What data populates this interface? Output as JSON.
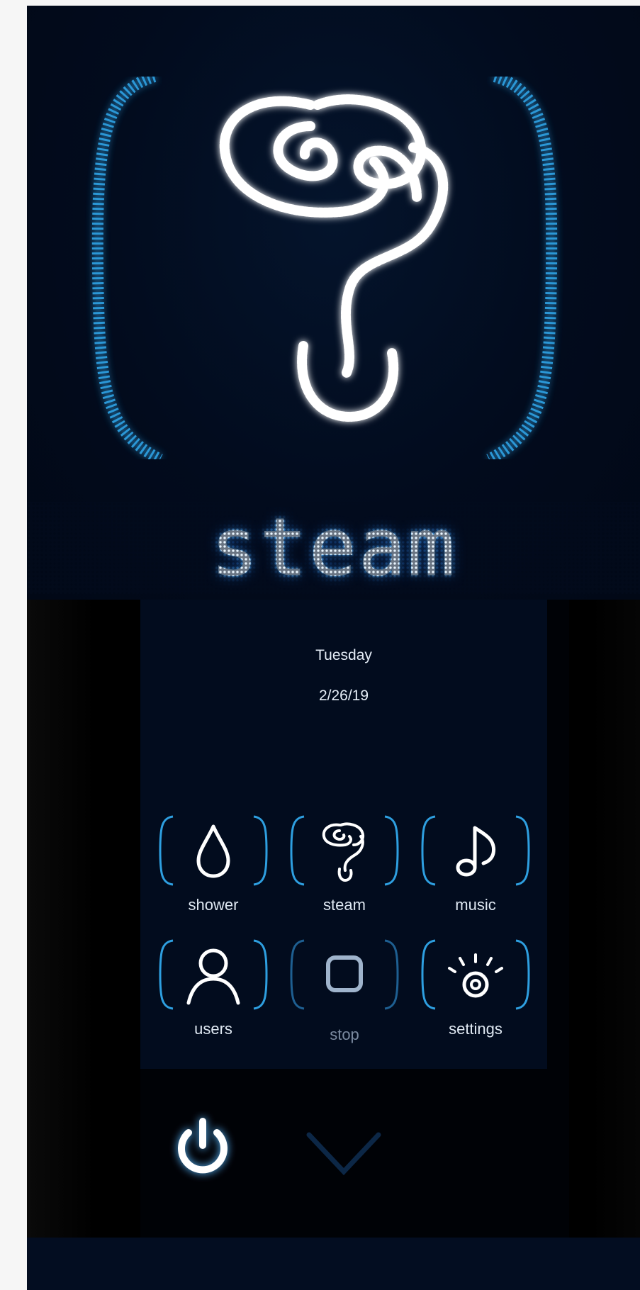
{
  "hero": {
    "mode_label": "steam",
    "icon": "steam-icon"
  },
  "status": {
    "day": "Tuesday",
    "date": "2/26/19"
  },
  "menu": [
    {
      "label": "shower",
      "icon": "water-drop-icon"
    },
    {
      "label": "steam",
      "icon": "steam-icon"
    },
    {
      "label": "music",
      "icon": "music-note-icon"
    },
    {
      "label": "users",
      "icon": "user-icon"
    },
    {
      "label": "stop",
      "icon": "stop-icon"
    },
    {
      "label": "settings",
      "icon": "settings-icon"
    }
  ],
  "controls": {
    "power": "power-icon",
    "expand": "chevron-down-icon"
  },
  "colors": {
    "glow": "#58b8ff",
    "bracket": "#2e9fe0",
    "text": "#eaf6ff",
    "background": "#020b1d"
  }
}
